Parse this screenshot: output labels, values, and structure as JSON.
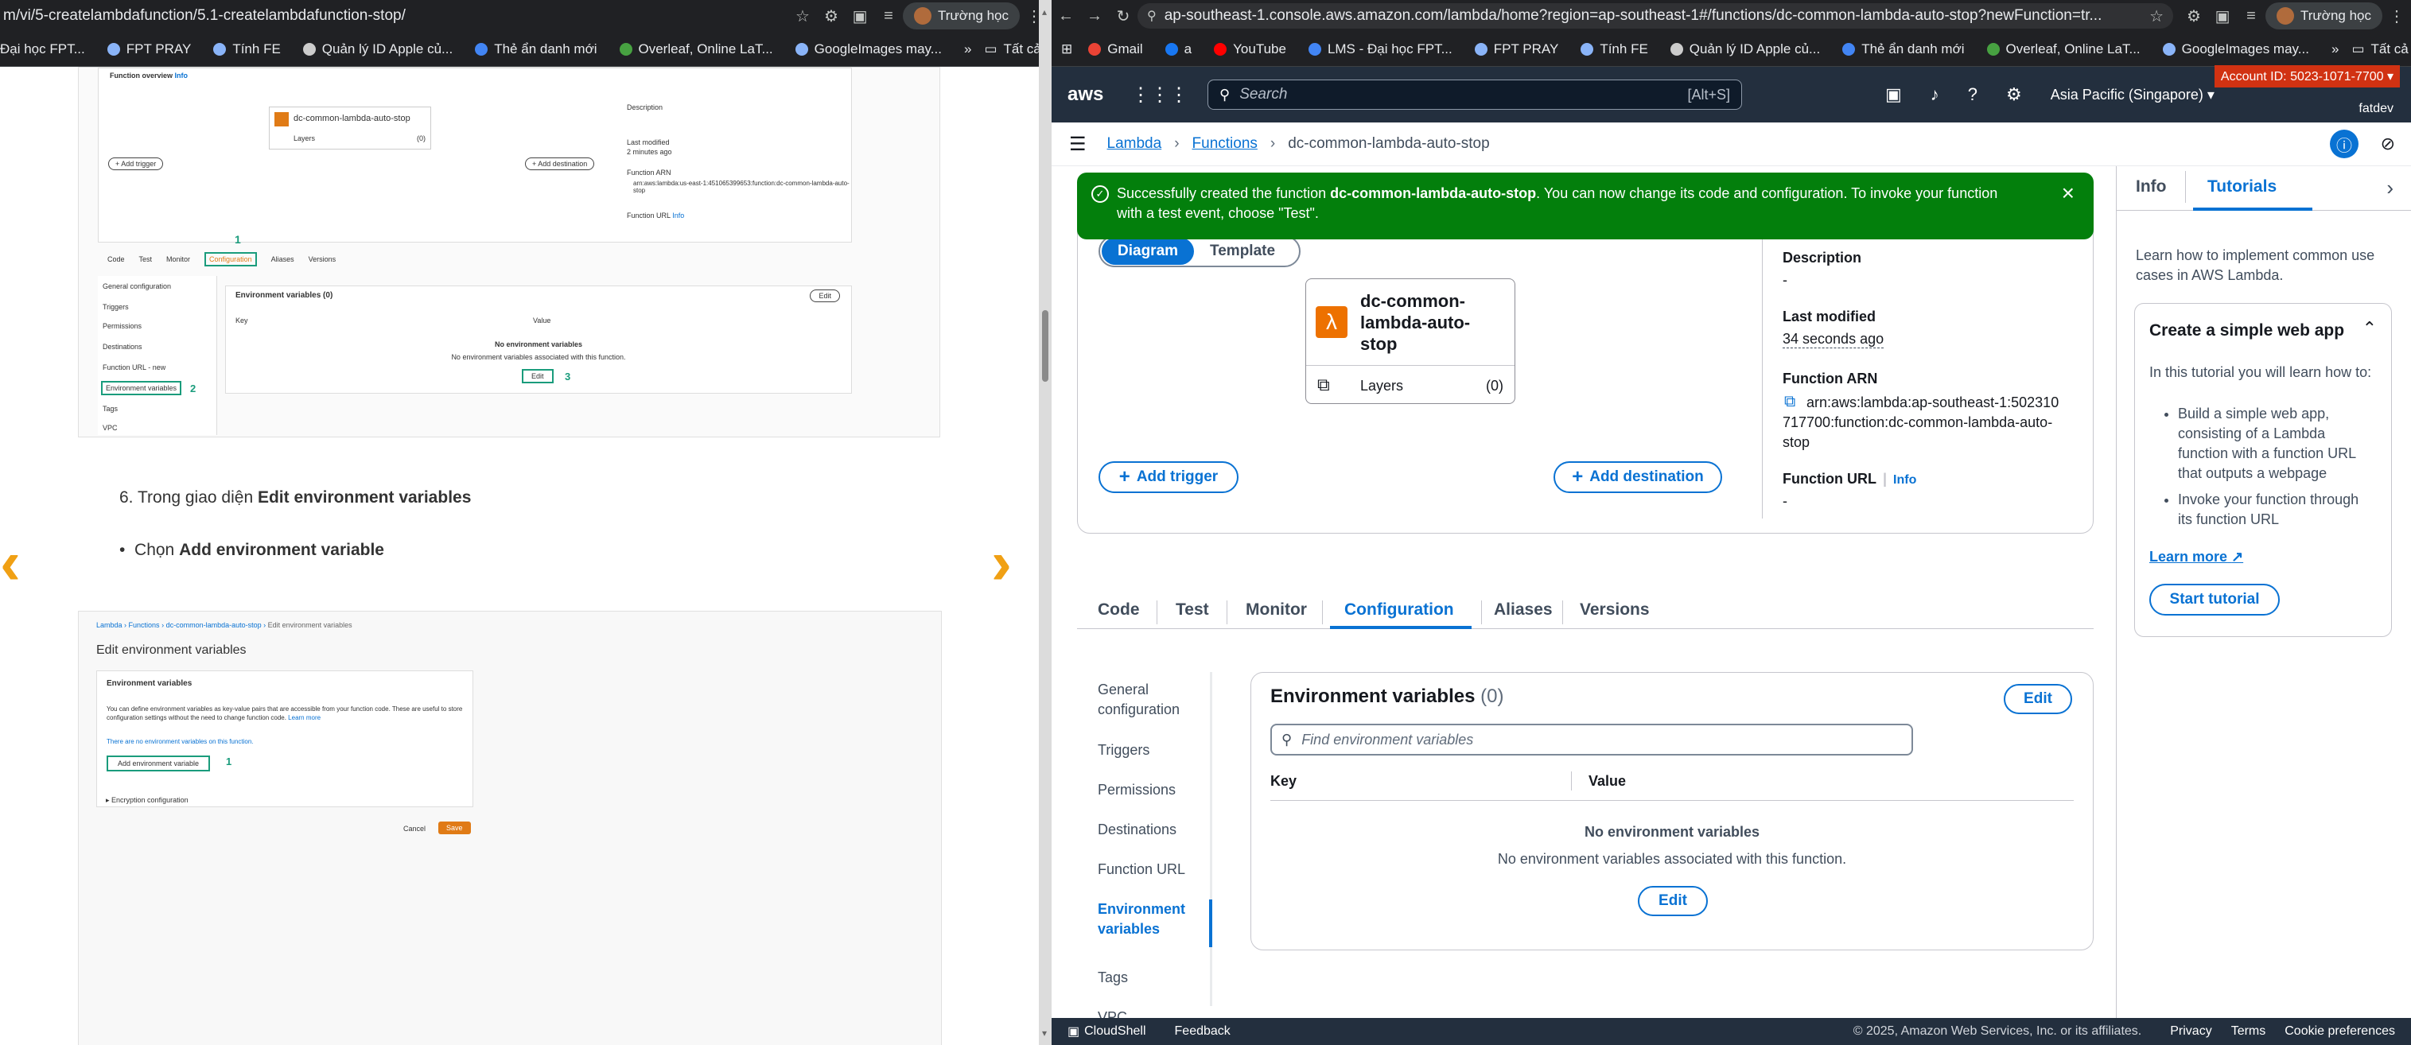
{
  "left_browser": {
    "url": "m/vi/5-createlambdafunction/5.1-createlambdafunction-stop/",
    "profile": "Trường học",
    "bookmarks": [
      "Đại học FPT...",
      "FPT PRAY",
      "Tính FE",
      "Quản lý ID Apple củ...",
      "Thẻ ẩn danh mới",
      "Overleaf, Online LaT...",
      "GoogleImages may..."
    ],
    "all_bookmarks": "Tất cả dấu trang"
  },
  "right_browser": {
    "url": "ap-southeast-1.console.aws.amazon.com/lambda/home?region=ap-southeast-1#/functions/dc-common-lambda-auto-stop?newFunction=tr...",
    "profile": "Trường học",
    "bookmarks": [
      "Gmail",
      "a",
      "YouTube",
      "LMS - Đại học FPT...",
      "FPT PRAY",
      "Tính FE",
      "Quản lý ID Apple củ...",
      "Thẻ ẩn danh mới",
      "Overleaf, Online LaT...",
      "GoogleImages may..."
    ],
    "all_bookmarks": "Tất cả dấu trang"
  },
  "doc": {
    "step_text_prefix": "6. Trong giao diện ",
    "step_text_bold": "Edit environment variables",
    "bullet_prefix": "Chọn ",
    "bullet_bold": "Add environment variable",
    "shot1": {
      "function_overview": "Function overview",
      "info": "Info",
      "fn_name": "dc-common-lambda-auto-stop",
      "layers": "Layers",
      "layers_count": "(0)",
      "add_trigger": "+ Add trigger",
      "add_destination": "+ Add destination",
      "description": "Description",
      "last_modified": "Last modified",
      "last_modified_val": "2 minutes ago",
      "function_arn": "Function ARN",
      "arn_val": "arn:aws:lambda:us-east-1:451065399653:function:dc-common-lambda-auto-stop",
      "function_url": "Function URL",
      "tabs": [
        "Code",
        "Test",
        "Monitor",
        "Configuration",
        "Aliases",
        "Versions"
      ],
      "nav": [
        "General configuration",
        "Triggers",
        "Permissions",
        "Destinations",
        "Function URL - new",
        "Environment variables",
        "Tags",
        "VPC"
      ],
      "env_title": "Environment variables",
      "env_count": "(0)",
      "edit": "Edit",
      "key": "Key",
      "value": "Value",
      "no_env": "No environment variables",
      "no_env_sub": "No environment variables associated with this function.",
      "n1": "1",
      "n2": "2",
      "n3": "3"
    },
    "shot2": {
      "breadcrumb": [
        "Lambda",
        "Functions",
        "dc-common-lambda-auto-stop",
        "Edit environment variables"
      ],
      "title": "Edit environment variables",
      "panel_title": "Environment variables",
      "desc": "You can define environment variables as key-value pairs that are accessible from your function code. These are useful to store configuration settings without the need to change function code.",
      "learn_more": "Learn more",
      "none": "There are no environment variables on this function.",
      "add_btn": "Add environment variable",
      "n1": "1",
      "encryption": "Encryption configuration",
      "cancel": "Cancel",
      "save": "Save"
    }
  },
  "aws": {
    "search_placeholder": "Search",
    "search_shortcut": "[Alt+S]",
    "region": "Asia Pacific (Singapore)",
    "account": "Account ID: 5023-1071-7700",
    "user": "fatdev",
    "breadcrumb": [
      "Lambda",
      "Functions",
      "dc-common-lambda-auto-stop"
    ],
    "flash_prefix": "Successfully created the function ",
    "flash_fn": "dc-common-lambda-auto-stop",
    "flash_suffix": ". You can now change its code and configuration. To invoke your function with a test event, choose \"Test\".",
    "seg": [
      "Diagram",
      "Template"
    ],
    "fn_name": "dc-common-lambda-auto-stop",
    "layers": "Layers",
    "layers_count": "(0)",
    "add_trigger": "Add trigger",
    "add_destination": "Add destination",
    "description": "Description",
    "description_val": "-",
    "last_modified": "Last modified",
    "last_modified_val": "34 seconds ago",
    "function_arn": "Function ARN",
    "arn_val": "arn:aws:lambda:ap-southeast-1:502310717700:function:dc-common-lambda-auto-stop",
    "function_url": "Function URL",
    "info": "Info",
    "function_url_val": "-",
    "tabs": [
      "Code",
      "Test",
      "Monitor",
      "Configuration",
      "Aliases",
      "Versions"
    ],
    "nav": [
      "General configuration",
      "Triggers",
      "Permissions",
      "Destinations",
      "Function URL",
      "Environment variables",
      "Tags",
      "VPC"
    ],
    "env_title": "Environment variables",
    "env_count": "(0)",
    "edit": "Edit",
    "find_placeholder": "Find environment variables",
    "key": "Key",
    "value": "Value",
    "no_env": "No environment variables",
    "no_env_sub": "No environment variables associated with this function.",
    "panel_tabs": [
      "Info",
      "Tutorials"
    ],
    "panel_intro": "Learn how to implement common use cases in AWS Lambda.",
    "tut_title": "Create a simple web app",
    "tut_desc": "In this tutorial you will learn how to:",
    "tut_items": [
      "Build a simple web app, consisting of a Lambda function with a function URL that outputs a webpage",
      "Invoke your function through its function URL"
    ],
    "learn_more": "Learn more",
    "start": "Start tutorial",
    "footer": {
      "cloudshell": "CloudShell",
      "feedback": "Feedback",
      "copyright": "© 2025, Amazon Web Services, Inc. or its affiliates.",
      "privacy": "Privacy",
      "terms": "Terms",
      "cookie": "Cookie preferences"
    }
  }
}
